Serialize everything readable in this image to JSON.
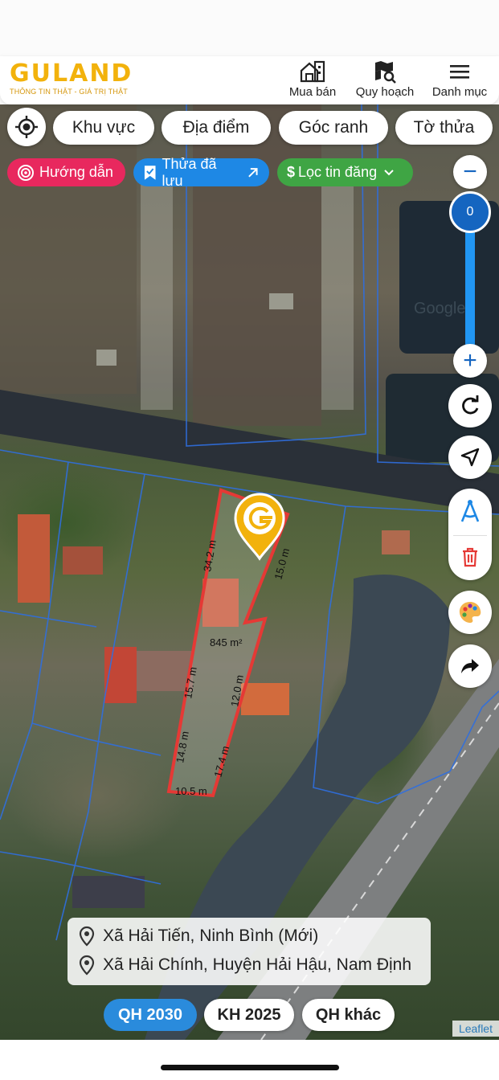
{
  "app": {
    "logo_text": "GULAND",
    "tagline": "THÔNG TIN THẬT - GIÁ TRỊ THẬT",
    "accent": "#f2b20c"
  },
  "nav": {
    "buy_sell": "Mua bán",
    "planning": "Quy hoạch",
    "menu": "Danh mục"
  },
  "filters": {
    "area": "Khu vực",
    "place": "Địa điểm",
    "corner": "Góc ranh",
    "sheet": "Tờ thửa"
  },
  "chips": {
    "guide": "Hướng dẫn",
    "saved": "Thửa đã lưu",
    "filter": "Lọc tin đăng",
    "guide_color": "#e8285e",
    "saved_color": "#1e88e5",
    "filter_color": "#3fa544"
  },
  "zoom": {
    "level": "0",
    "minus": "−",
    "plus": "+"
  },
  "map": {
    "attribution": "Leaflet",
    "watermark": "Google",
    "parcel": {
      "area": "845 m²",
      "edges": [
        "34.2 m",
        "15.0 m",
        "15.7 m",
        "12.0 m",
        "14.8 m",
        "17.4 m",
        "10.5 m"
      ]
    }
  },
  "info": {
    "address_new": "Xã Hải Tiến, Ninh Bình (Mới)",
    "address_old": "Xã Hải Chính, Huyện Hải Hậu, Nam Định"
  },
  "plan_tabs": {
    "qh2030": "QH 2030",
    "kh2025": "KH 2025",
    "other": "QH khác"
  },
  "icons": [
    "house-icon",
    "map-search-icon",
    "menu-icon",
    "locate-icon",
    "guide-icon",
    "bookmark-icon",
    "arrow-up-right-icon",
    "dollar-icon",
    "chevron-down-icon",
    "refresh-icon",
    "navigate-icon",
    "measure-icon",
    "trash-icon",
    "palette-icon",
    "share-icon",
    "pin-icon",
    "marker-icon"
  ]
}
